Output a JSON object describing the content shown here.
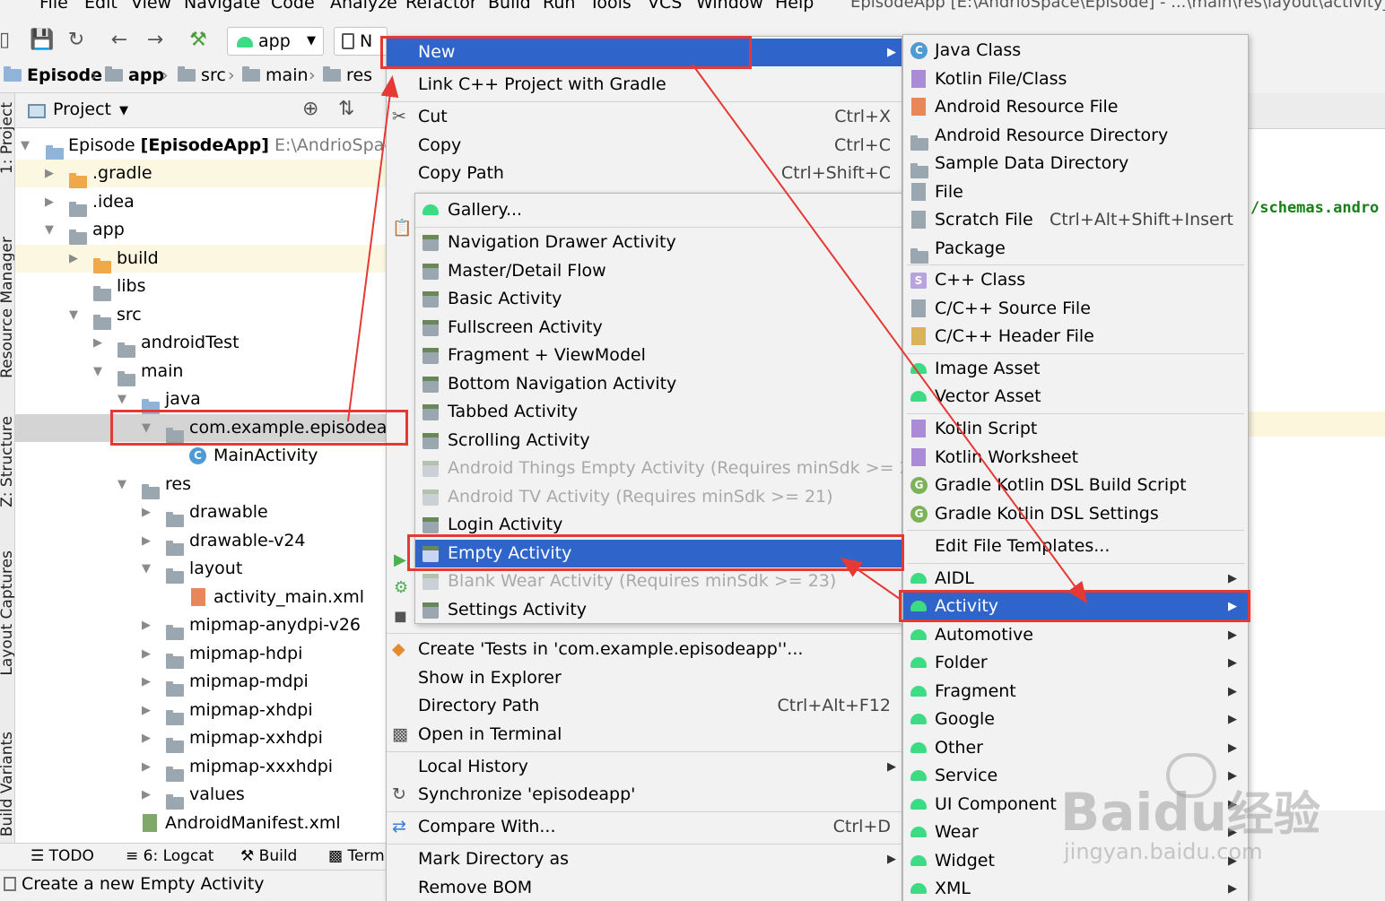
{
  "menubar": {
    "items": [
      "File",
      "Edit",
      "View",
      "Navigate",
      "Code",
      "Analyze",
      "Refactor",
      "Build",
      "Run",
      "Tools",
      "VCS",
      "Window",
      "Help"
    ],
    "window_title": "EpisodeApp [E:\\AndrioSpace\\Episode] - ...\\main\\res\\layout\\activity_m"
  },
  "toolbar": {
    "run_config": "app",
    "device_prefix": "N"
  },
  "breadcrumb": {
    "items": [
      "Episode",
      "app",
      "src",
      "main",
      "res"
    ]
  },
  "project_panel": {
    "title": "Project",
    "tree": [
      {
        "label": "Episode",
        "bold_suffix": "[EpisodeApp]",
        "path": "E:\\AndrioSpace\\E"
      },
      {
        "label": ".gradle"
      },
      {
        "label": ".idea"
      },
      {
        "label": "app"
      },
      {
        "label": "build"
      },
      {
        "label": "libs"
      },
      {
        "label": "src"
      },
      {
        "label": "androidTest"
      },
      {
        "label": "main"
      },
      {
        "label": "java"
      },
      {
        "label": "com.example.episodeapp"
      },
      {
        "label": "MainActivity"
      },
      {
        "label": "res"
      },
      {
        "label": "drawable"
      },
      {
        "label": "drawable-v24"
      },
      {
        "label": "layout"
      },
      {
        "label": "activity_main.xml"
      },
      {
        "label": "mipmap-anydpi-v26"
      },
      {
        "label": "mipmap-hdpi"
      },
      {
        "label": "mipmap-mdpi"
      },
      {
        "label": "mipmap-xhdpi"
      },
      {
        "label": "mipmap-xxhdpi"
      },
      {
        "label": "mipmap-xxxhdpi"
      },
      {
        "label": "values"
      },
      {
        "label": "AndroidManifest.xml"
      }
    ]
  },
  "side_tabs": [
    "1: Project",
    "Resource Manager",
    "Z: Structure",
    "Layout Captures",
    "Build Variants"
  ],
  "bottom_tabs": [
    "TODO",
    "6: Logcat",
    "Build",
    "Term"
  ],
  "status_text": "Create a new Empty Activity",
  "editor_text": "/schemas.andro",
  "context_menu": [
    {
      "label": "New",
      "shortcut": ""
    },
    {
      "label": "Link C++ Project with Gradle",
      "shortcut": ""
    },
    {
      "label": "Cut",
      "shortcut": "Ctrl+X"
    },
    {
      "label": "Copy",
      "shortcut": "Ctrl+C"
    },
    {
      "label": "Copy Path",
      "shortcut": "Ctrl+Shift+C"
    },
    {
      "label": "Create 'Tests in 'com.example.episodeapp''...",
      "shortcut": ""
    },
    {
      "label": "Show in Explorer",
      "shortcut": ""
    },
    {
      "label": "Directory Path",
      "shortcut": "Ctrl+Alt+F12"
    },
    {
      "label": "Open in Terminal",
      "shortcut": ""
    },
    {
      "label": "Local History",
      "shortcut": ""
    },
    {
      "label": "Synchronize 'episodeapp'",
      "shortcut": ""
    },
    {
      "label": "Compare With...",
      "shortcut": "Ctrl+D"
    },
    {
      "label": "Mark Directory as",
      "shortcut": ""
    },
    {
      "label": "Remove BOM",
      "shortcut": ""
    }
  ],
  "activity_menu": [
    "Gallery...",
    "Navigation Drawer Activity",
    "Master/Detail Flow",
    "Basic Activity",
    "Fullscreen Activity",
    "Fragment + ViewModel",
    "Bottom Navigation Activity",
    "Tabbed Activity",
    "Scrolling Activity",
    "Android Things Empty Activity (Requires minSdk >= 24)",
    "Android TV Activity (Requires minSdk >= 21)",
    "Login Activity",
    "Empty Activity",
    "Blank Wear Activity (Requires minSdk >= 23)",
    "Settings Activity"
  ],
  "new_menu": [
    {
      "label": "Java Class",
      "shortcut": ""
    },
    {
      "label": "Kotlin File/Class",
      "shortcut": ""
    },
    {
      "label": "Android Resource File",
      "shortcut": ""
    },
    {
      "label": "Android Resource Directory",
      "shortcut": ""
    },
    {
      "label": "Sample Data Directory",
      "shortcut": ""
    },
    {
      "label": "File",
      "shortcut": ""
    },
    {
      "label": "Scratch File",
      "shortcut": "Ctrl+Alt+Shift+Insert"
    },
    {
      "label": "Package",
      "shortcut": ""
    },
    {
      "label": "C++ Class",
      "shortcut": ""
    },
    {
      "label": "C/C++ Source File",
      "shortcut": ""
    },
    {
      "label": "C/C++ Header File",
      "shortcut": ""
    },
    {
      "label": "Image Asset",
      "shortcut": ""
    },
    {
      "label": "Vector Asset",
      "shortcut": ""
    },
    {
      "label": "Kotlin Script",
      "shortcut": ""
    },
    {
      "label": "Kotlin Worksheet",
      "shortcut": ""
    },
    {
      "label": "Gradle Kotlin DSL Build Script",
      "shortcut": ""
    },
    {
      "label": "Gradle Kotlin DSL Settings",
      "shortcut": ""
    },
    {
      "label": "Edit File Templates...",
      "shortcut": ""
    },
    {
      "label": "AIDL",
      "shortcut": ""
    },
    {
      "label": "Activity",
      "shortcut": ""
    },
    {
      "label": "Automotive",
      "shortcut": ""
    },
    {
      "label": "Folder",
      "shortcut": ""
    },
    {
      "label": "Fragment",
      "shortcut": ""
    },
    {
      "label": "Google",
      "shortcut": ""
    },
    {
      "label": "Other",
      "shortcut": ""
    },
    {
      "label": "Service",
      "shortcut": ""
    },
    {
      "label": "UI Component",
      "shortcut": ""
    },
    {
      "label": "Wear",
      "shortcut": ""
    },
    {
      "label": "Widget",
      "shortcut": ""
    },
    {
      "label": "XML",
      "shortcut": ""
    }
  ],
  "watermark": {
    "line1": "Bai",
    "line1b": "du",
    "line1c": "经验",
    "line2": "jingyan.baidu.com"
  },
  "colors": {
    "selection": "#2f65ca",
    "annotation": "#e53935",
    "android_green": "#3ddc84"
  }
}
